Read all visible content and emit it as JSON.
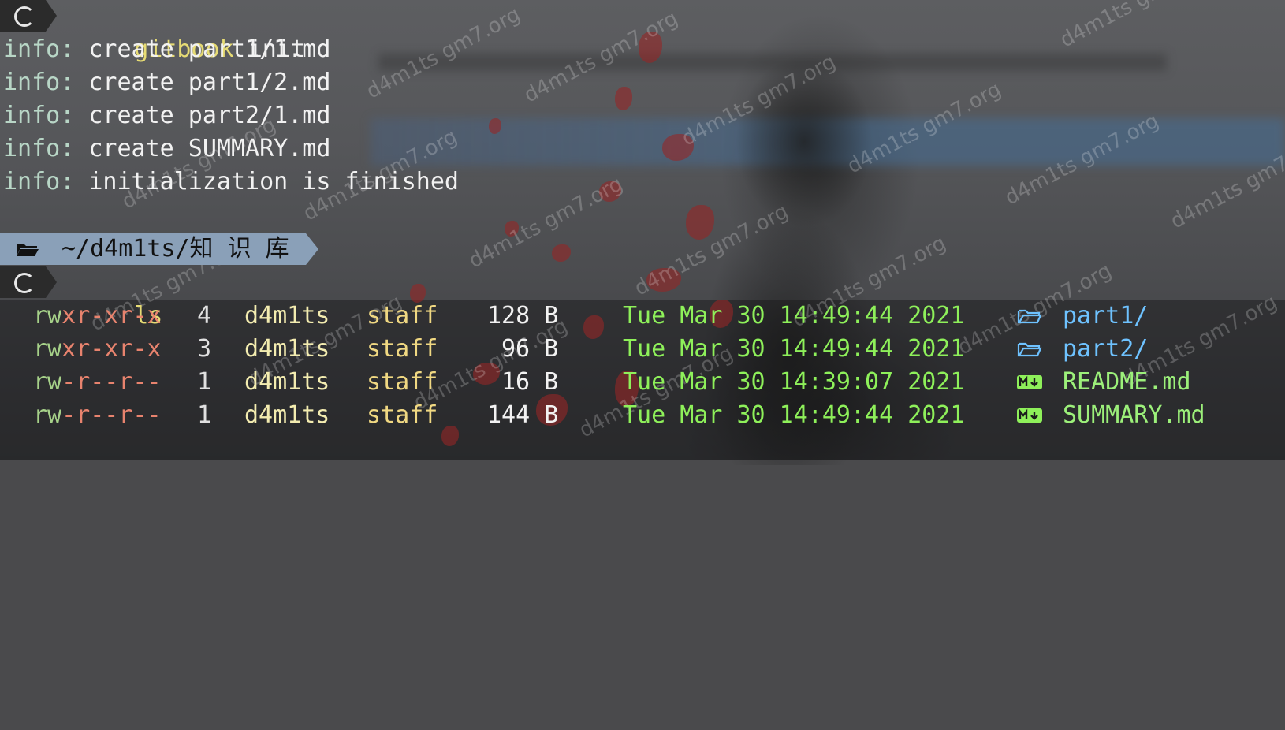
{
  "terminal": {
    "prompt1": {
      "command": "gitbook",
      "argument": " init"
    },
    "output": [
      {
        "label": "info:",
        "text": " create part1/1.md"
      },
      {
        "label": "info:",
        "text": " create part1/2.md"
      },
      {
        "label": "info:",
        "text": " create part2/1.md"
      },
      {
        "label": "info:",
        "text": " create SUMMARY.md"
      },
      {
        "label": "info:",
        "text": " initialization is finished"
      }
    ],
    "path_bar": {
      "path": "~/d4m1ts/知 识 库"
    },
    "prompt2": {
      "command": "ls"
    },
    "listing": [
      {
        "perm_a": "rw",
        "perm_b": "x",
        "perm_c": "r-xr-x",
        "links": "4",
        "owner": "d4m1ts",
        "group": "staff",
        "size": "128 B",
        "date": "Tue Mar 30 14:49:44 2021",
        "icon": "folder-icon",
        "name": "part1/"
      },
      {
        "perm_a": "rw",
        "perm_b": "x",
        "perm_c": "r-xr-x",
        "links": "3",
        "owner": "d4m1ts",
        "group": "staff",
        "size": "96 B",
        "date": "Tue Mar 30 14:49:44 2021",
        "icon": "folder-icon",
        "name": "part2/"
      },
      {
        "perm_a": "rw",
        "perm_b": "-",
        "perm_c": "r--r--",
        "links": "1",
        "owner": "d4m1ts",
        "group": "staff",
        "size": "16 B",
        "date": "Tue Mar 30 14:39:07 2021",
        "icon": "markdown-icon",
        "name": "README.md"
      },
      {
        "perm_a": "rw",
        "perm_b": "-",
        "perm_c": "r--r--",
        "links": "1",
        "owner": "d4m1ts",
        "group": "staff",
        "size": "144 B",
        "date": "Tue Mar 30 14:49:44 2021",
        "icon": "markdown-icon",
        "name": "SUMMARY.md"
      }
    ]
  },
  "watermark": {
    "text": "d4m1ts gm7.org"
  },
  "colors": {
    "command": "#e6db74",
    "info_label": "#b8d6c6",
    "path_bar": "#8aa0b8",
    "date": "#8ef05a",
    "folder_name": "#6ec2ff",
    "markdown_name": "#9cf07a"
  }
}
